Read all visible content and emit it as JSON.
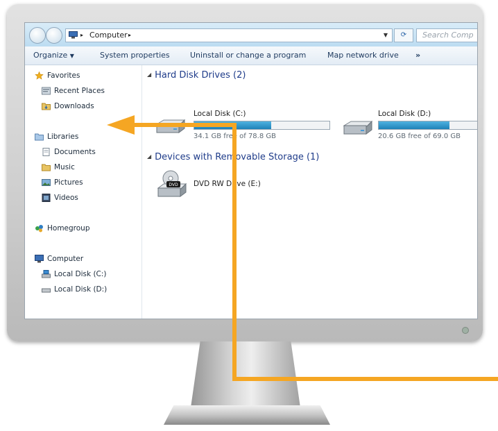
{
  "address": {
    "path": "Computer",
    "search_placeholder": "Search Comp"
  },
  "toolbar": {
    "organize": "Organize",
    "system_properties": "System properties",
    "uninstall": "Uninstall or change a program",
    "map_drive": "Map network drive",
    "more": "»"
  },
  "sidebar": {
    "favorites": "Favorites",
    "recent_places": "Recent Places",
    "downloads": "Downloads",
    "libraries": "Libraries",
    "documents": "Documents",
    "music": "Music",
    "pictures": "Pictures",
    "videos": "Videos",
    "homegroup": "Homegroup",
    "computer": "Computer",
    "local_disk_c": "Local Disk (C:)",
    "local_disk_d": "Local Disk (D:)"
  },
  "hard_disks": {
    "header": "Hard Disk Drives (2)",
    "drives": [
      {
        "name": "Local Disk (C:)",
        "free_text": "34.1 GB free of 78.8 GB",
        "used_fraction": 0.57
      },
      {
        "name": "Local Disk (D:)",
        "free_text": "20.6 GB free of 69.0 GB",
        "used_fraction": 0.7
      }
    ]
  },
  "removable": {
    "header": "Devices with Removable Storage (1)",
    "dvd_name": "DVD RW Drive (E:)"
  },
  "colors": {
    "accent": "#f5a623",
    "header_text": "#1f3c8a",
    "bar_fill": "#1e82b8"
  }
}
